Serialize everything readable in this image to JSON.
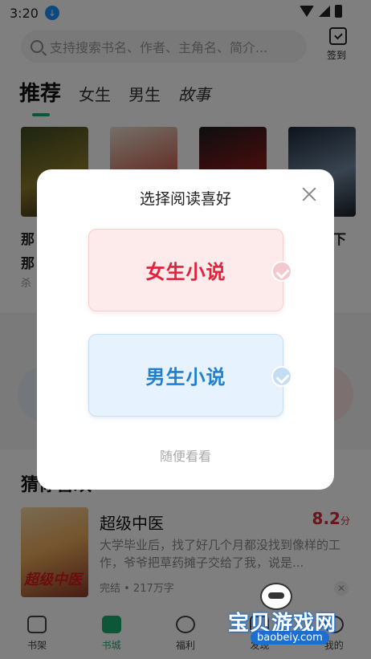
{
  "status_bar": {
    "time": "3:20"
  },
  "search": {
    "placeholder": "支持搜索书名、作者、主角名、简介..."
  },
  "signin": {
    "label": "签到"
  },
  "tabs": [
    {
      "label": "推荐",
      "active": true
    },
    {
      "label": "女生"
    },
    {
      "label": "男生"
    },
    {
      "label": "故事"
    }
  ],
  "books_partial": {
    "title_left_line1": "那",
    "title_left_line2": "那",
    "author_left": "杀",
    "title_right": "下"
  },
  "guess": {
    "title": "猜你喜欢",
    "book": {
      "title": "超级中医",
      "score": "8.2",
      "score_unit": "分",
      "desc": "大学毕业后，找了好几个月都没找到像样的工作，爷爷把草药摊子交给了我，说是...",
      "meta": "完结 • 217万字",
      "cover_text": "超级中医"
    }
  },
  "bottom_nav": [
    {
      "label": "书架",
      "active": false
    },
    {
      "label": "书城",
      "active": true
    },
    {
      "label": "福利",
      "active": false
    },
    {
      "label": "发现",
      "active": false
    },
    {
      "label": "我的",
      "active": false
    }
  ],
  "modal": {
    "title": "选择阅读喜好",
    "options": [
      {
        "label": "女生小说",
        "color": "#e0223a"
      },
      {
        "label": "男生小说",
        "color": "#1f7fd1"
      }
    ],
    "skip_label": "随便看看"
  },
  "watermark": {
    "title": "宝贝游戏网",
    "url": "baobeiy.com"
  },
  "colors": {
    "accent": "#1aad6e",
    "score": "#d62a3a"
  }
}
